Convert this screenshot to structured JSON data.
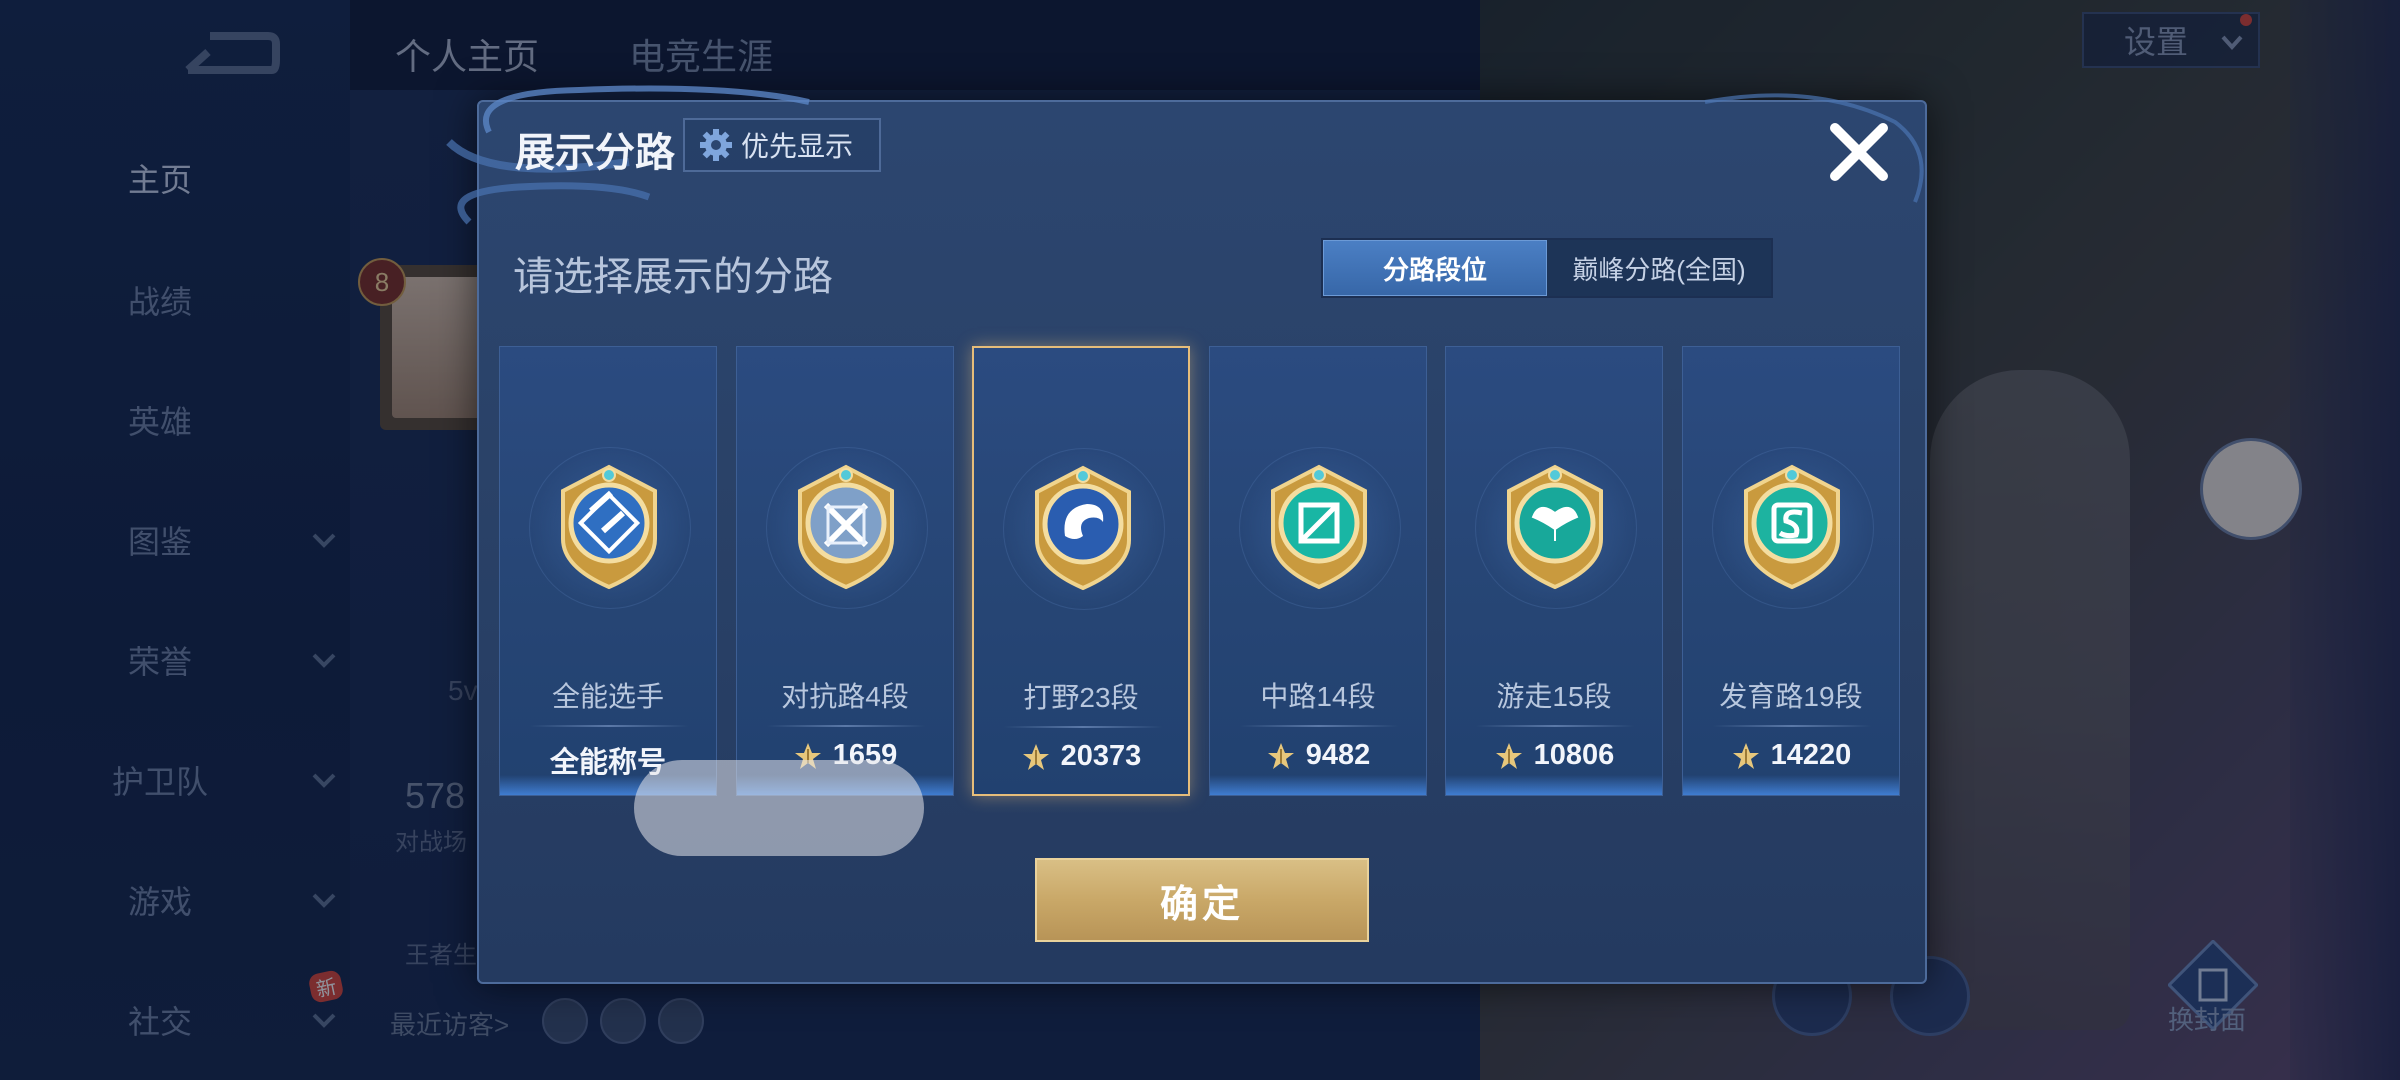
{
  "sidebar": {
    "items": [
      {
        "label": "主页",
        "active": true
      },
      {
        "label": "战绩"
      },
      {
        "label": "英雄"
      },
      {
        "label": "图鉴",
        "expandable": true
      },
      {
        "label": "荣誉",
        "expandable": true
      },
      {
        "label": "护卫队",
        "expandable": true
      },
      {
        "label": "游戏",
        "expandable": true
      },
      {
        "label": "社交",
        "expandable": true,
        "badge": "新"
      }
    ]
  },
  "top_tabs": [
    {
      "label": "个人主页",
      "active": true
    },
    {
      "label": "电竞生涯"
    }
  ],
  "profile": {
    "level": "8",
    "stat_value": "578",
    "stat_label": "对战场",
    "king_label": "王者生",
    "fivev": "5v",
    "visitors_label": "最近访客>"
  },
  "settings": {
    "label": "设置"
  },
  "cover": {
    "label": "换封面"
  },
  "modal": {
    "title": "展示分路",
    "priority_label": "优先显示",
    "subtitle": "请选择展示的分路",
    "toggle": {
      "active": "分路段位",
      "inactive": "巅峰分路(全国)"
    },
    "cards": [
      {
        "lane": "全能选手",
        "score": "全能称号",
        "score_icon": false,
        "selected": false,
        "medal_color": "#2f6fc2",
        "symbol": "all-round-icon"
      },
      {
        "lane": "对抗路4段",
        "score": "1659",
        "score_icon": true,
        "selected": false,
        "medal_color": "#7fa0c8",
        "symbol": "swords-icon"
      },
      {
        "lane": "打野23段",
        "score": "20373",
        "score_icon": true,
        "selected": true,
        "medal_color": "#2a5db0",
        "symbol": "dragon-icon"
      },
      {
        "lane": "中路14段",
        "score": "9482",
        "score_icon": true,
        "selected": false,
        "medal_color": "#19b6a4",
        "symbol": "mid-lane-icon"
      },
      {
        "lane": "游走15段",
        "score": "10806",
        "score_icon": true,
        "selected": false,
        "medal_color": "#18a89a",
        "symbol": "wings-icon"
      },
      {
        "lane": "发育路19段",
        "score": "14220",
        "score_icon": true,
        "selected": false,
        "medal_color": "#1db3a0",
        "symbol": "farm-lane-icon"
      }
    ],
    "confirm_label": "确定"
  },
  "colors": {
    "accent_gold": "#e6bd7a",
    "toggle_blue": "#3f73b8",
    "modal_bg": "#2a4268"
  }
}
